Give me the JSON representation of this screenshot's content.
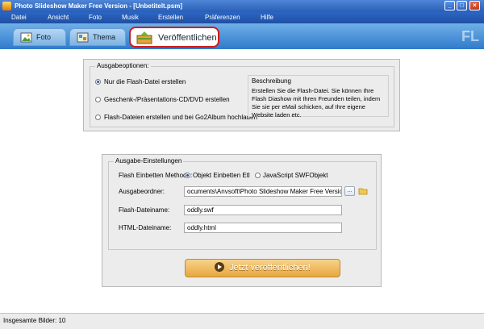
{
  "window": {
    "title": "Photo Slideshow Maker Free Version - [Unbetitelt.psm]"
  },
  "menu": [
    "Datei",
    "Ansicht",
    "Foto",
    "Musik",
    "Erstellen",
    "Präferenzen",
    "Hilfe"
  ],
  "tabs": [
    {
      "label": "Foto",
      "icon": "photo-icon",
      "active": false
    },
    {
      "label": "Thema",
      "icon": "theme-icon",
      "active": false
    },
    {
      "label": "Veröffentlichen",
      "icon": "publish-icon",
      "active": true
    }
  ],
  "output_options": {
    "legend": "Ausgabeoptionen:",
    "options": [
      {
        "label": "Nur die Flash-Datei erstellen",
        "checked": true
      },
      {
        "label": "Geschenk-/Präsentations-CD/DVD erstellen",
        "checked": false
      },
      {
        "label": "Flash-Dateien erstellen und bei Go2Album hochladen",
        "checked": false
      }
    ],
    "description": {
      "title": "Beschreibung",
      "text": "Erstellen Sie die Flash-Datei. Sie können Ihre Flash Diashow mit Ihren Freunden teilen, indem Sie sie per eMail schicken, auf Ihre eigene Website laden etc."
    }
  },
  "output_settings": {
    "legend": "Ausgabe-Einstellungen",
    "embed_label": "Flash Einbetten Methode:",
    "embed_options": [
      {
        "label": "Objekt Einbetten Etl",
        "checked": true
      },
      {
        "label": "JavaScript SWFObjekt",
        "checked": false
      }
    ],
    "folder_label": "Ausgabeordner:",
    "folder_value": "ocuments\\Anvsoft\\Photo Slideshow Maker Free Version\\putput\\",
    "browse_label": "...",
    "flash_label": "Flash-Dateiname:",
    "flash_value": "oddly.swf",
    "html_label": "HTML-Dateiname:",
    "html_value": "oddly.html"
  },
  "publish_button": "Jetzt veröffentlichen!",
  "status": "Insgesamte Bilder: 10",
  "colors": {
    "accent": "#2a5fb5",
    "active_tab_border": "#d01c1c",
    "publish": "#e7a640"
  }
}
